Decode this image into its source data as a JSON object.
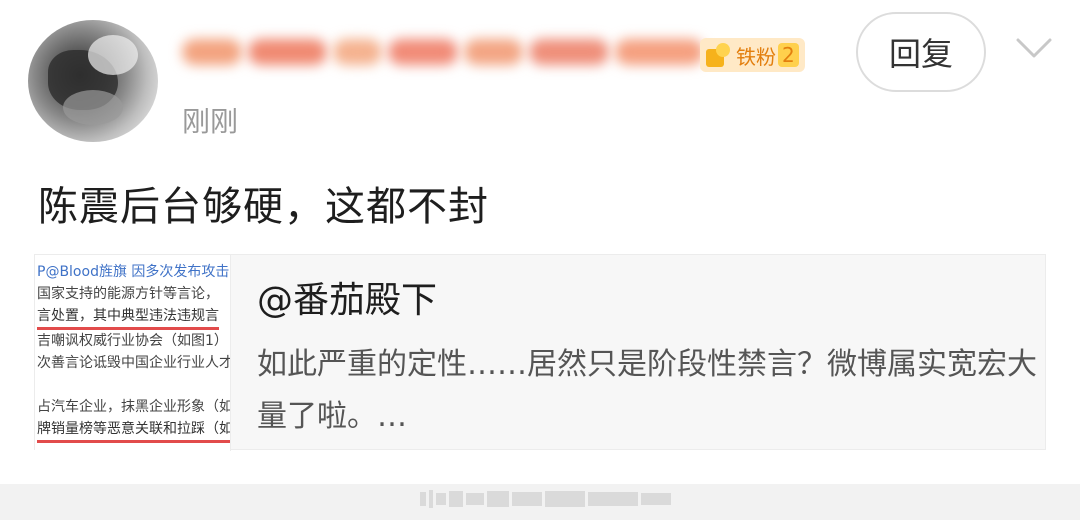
{
  "post": {
    "timestamp": "刚刚",
    "badge_text": "铁粉",
    "badge_level": "2",
    "reply_label": "回复",
    "comment": "陈震后台够硬，这都不封"
  },
  "quote": {
    "author": "@番茄殿下",
    "body": "如此严重的定性……居然只是阶段性禁言？微博属实宽宏大量了啦。…",
    "thumb_lines": [
      "P@Blood旌旗 因多次发布攻击",
      "国家支持的能源方针等言论，",
      "言处置，其中典型违法违规言",
      "吉嘲讽权威行业协会（如图1）",
      "次善言论诋毁中国企业行业人才",
      "",
      "占汽车企业，抹黑企业形象（如",
      "牌销量榜等恶意关联和拉踩（如"
    ]
  },
  "colors": {
    "accent_badge": "#e37f0e",
    "timestamp": "#999999",
    "quote_bg": "#f7f7f7"
  },
  "icons": {
    "more": "chevron-down-icon",
    "badge": "fan-badge-icon"
  }
}
